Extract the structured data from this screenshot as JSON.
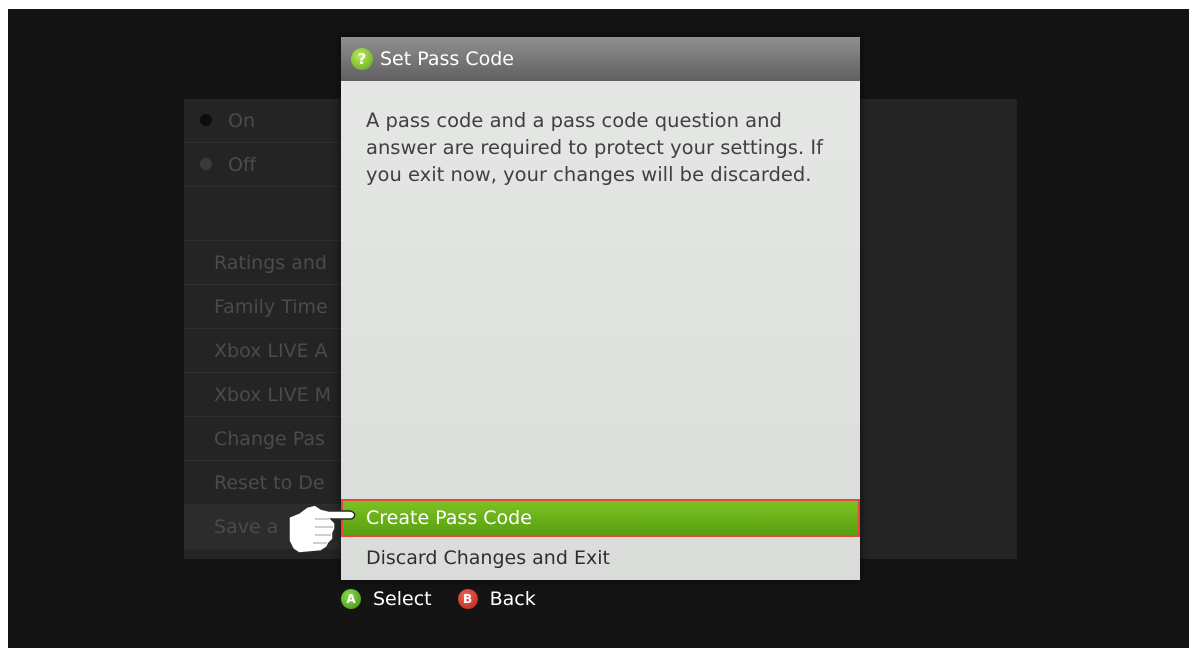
{
  "background_list": {
    "radio_on": "On",
    "radio_off": "Off",
    "items": [
      "Ratings and",
      "Family Time",
      "Xbox LIVE A",
      "Xbox LIVE M",
      "Change Pas",
      "Reset to De",
      "Save a"
    ]
  },
  "dialog": {
    "title": "Set Pass Code",
    "help_icon_glyph": "?",
    "message": "A pass code and a pass code question and answer are required to protect your settings. If you exit now, your changes will be discarded.",
    "options": [
      "Create Pass Code",
      "Discard Changes and Exit"
    ],
    "selected_index": 0
  },
  "footer": {
    "a_glyph": "A",
    "a_label": "Select",
    "b_glyph": "B",
    "b_label": "Back"
  },
  "colors": {
    "accent_green": "#6cb31c",
    "selection_border": "#e04a3a",
    "b_button": "#d23a2e"
  },
  "icons": {
    "help": "help-icon",
    "pointer": "pointing-hand-icon"
  }
}
